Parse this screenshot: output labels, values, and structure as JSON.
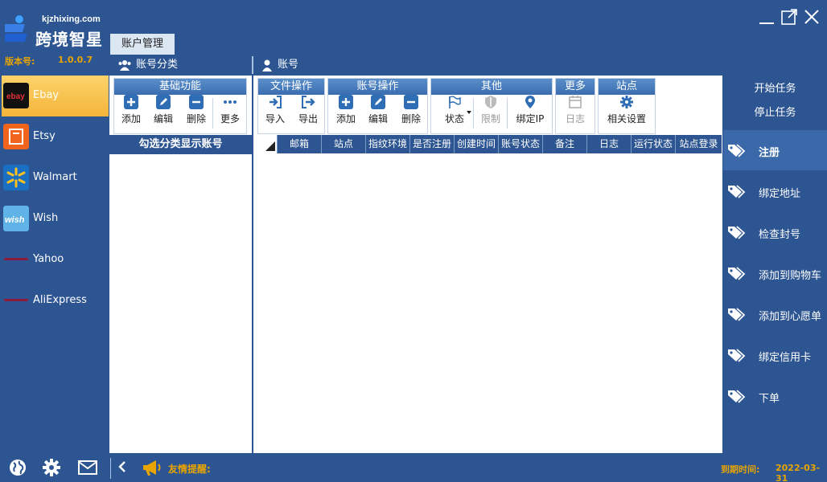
{
  "app": {
    "url": "kjzhixing.com",
    "name": "跨境智星",
    "version_label": "版本号:",
    "version": "1.0.0.7"
  },
  "tabs": {
    "account_mgmt": "账户管理"
  },
  "headers": {
    "category": "账号分类",
    "account": "账号"
  },
  "platforms": [
    {
      "label": "Ebay",
      "icon": "ebay-icon",
      "active": true
    },
    {
      "label": "Etsy",
      "icon": "etsy-icon"
    },
    {
      "label": "Walmart",
      "icon": "walmart-icon"
    },
    {
      "label": "Wish",
      "icon": "wish-icon"
    },
    {
      "label": "Yahoo",
      "icon": "yahoo-icon"
    },
    {
      "label": "AliExpress",
      "icon": "aliexpress-icon"
    }
  ],
  "category_toolbar": {
    "title": "基础功能",
    "add": "添加",
    "edit": "编辑",
    "delete": "删除",
    "more": "更多"
  },
  "category_list_header": "勾选分类显示账号",
  "main_toolbar": {
    "file_ops": {
      "title": "文件操作",
      "import": "导入",
      "export": "导出"
    },
    "account_ops": {
      "title": "账号操作",
      "add": "添加",
      "edit": "编辑",
      "delete": "删除"
    },
    "other": {
      "title": "其他",
      "status": "状态",
      "limit": "限制",
      "bind_ip": "绑定IP"
    },
    "more": {
      "title": "更多",
      "log": "日志"
    },
    "site": {
      "title": "站点",
      "settings": "相关设置"
    }
  },
  "table": {
    "columns": [
      "邮箱",
      "站点",
      "指纹环境",
      "是否注册",
      "创建时间",
      "账号状态",
      "备注",
      "日志",
      "运行状态",
      "站点登录"
    ],
    "rows": []
  },
  "right_top": {
    "start": "开始任务",
    "stop": "停止任务"
  },
  "right_actions": [
    {
      "label": "注册",
      "active": true
    },
    {
      "label": "绑定地址"
    },
    {
      "label": "检查封号"
    },
    {
      "label": "添加到购物车"
    },
    {
      "label": "添加到心愿单"
    },
    {
      "label": "绑定信用卡"
    },
    {
      "label": "下单"
    }
  ],
  "bottom": {
    "notice_label": "友情提醒:",
    "expire_label": "到期时间:",
    "expire_value": "2022-03-31"
  },
  "colors": {
    "background": "#2c5592",
    "accent": "#e8a400",
    "active_platform": "#f3b53a",
    "group_header": "#3a6db0"
  }
}
